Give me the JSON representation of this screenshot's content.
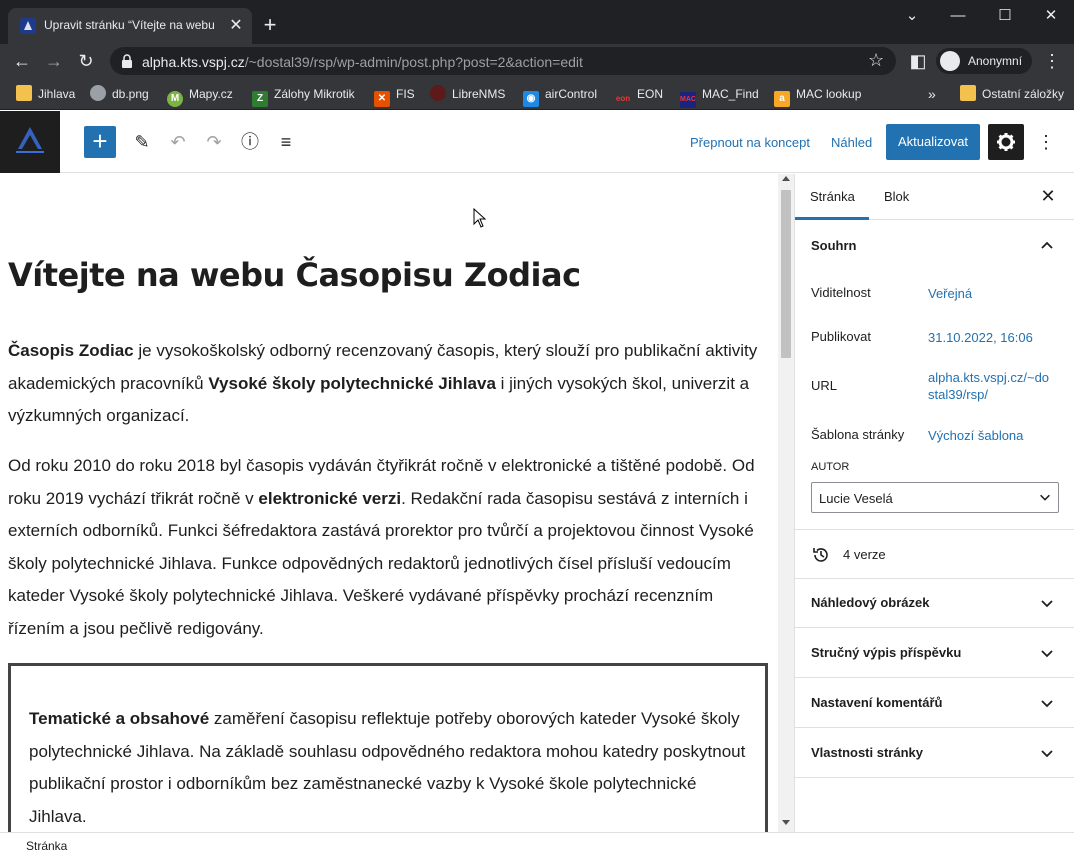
{
  "browser": {
    "tab_title": "Upravit stránku “Vítejte na webu",
    "url_host": "alpha.kts.vspj.cz",
    "url_path": "/~dostal39/rsp/wp-admin/post.php?post=2&action=edit",
    "profile_name": "Anonymní",
    "bookmarks": [
      {
        "label": "Jihlava",
        "icon": "folder-icon"
      },
      {
        "label": "db.png",
        "icon": "globe-icon"
      },
      {
        "label": "Mapy.cz",
        "icon": "mapy-icon"
      },
      {
        "label": "Zálohy Mikrotik",
        "icon": "mikrotik-icon"
      },
      {
        "label": "FIS",
        "icon": "fis-icon"
      },
      {
        "label": "LibreNMS",
        "icon": "librenms-icon"
      },
      {
        "label": "airControl",
        "icon": "aircontrol-icon"
      },
      {
        "label": "EON",
        "icon": "eon-icon"
      },
      {
        "label": "MAC_Find",
        "icon": "macfind-icon"
      },
      {
        "label": "MAC lookup",
        "icon": "maclookup-icon"
      }
    ],
    "overflow_label": "»",
    "other_bookmarks": "Ostatní záložky"
  },
  "editor": {
    "switch_to_draft": "Přepnout na koncept",
    "preview": "Náhled",
    "update": "Aktualizovat"
  },
  "post": {
    "title": "Vítejte na webu Časopisu Zodiac",
    "p1": [
      {
        "text": "Časopis Zodiac",
        "bold": true
      },
      {
        "text": " je vysokoškolský odborný recenzovaný časopis, který slouží pro publikační aktivity akademických pracovníků ",
        "bold": false
      },
      {
        "text": "Vysoké školy polytechnické Jihlava",
        "bold": true
      },
      {
        "text": " i jiných vysokých škol, univerzit a výzkumných organizací.",
        "bold": false
      }
    ],
    "p2": [
      {
        "text": "Od roku 2010 do roku 2018 byl časopis vydáván čtyřikrát ročně v elektronické a tištěné podobě. Od roku 2019 vychází třikrát ročně v ",
        "bold": false
      },
      {
        "text": "elektronické verzi",
        "bold": true
      },
      {
        "text": ". Redakční rada časopisu sestává z interních i externích odborníků. Funkci šéfredaktora zastává prorektor pro tvůrčí a projektovou činnost Vysoké školy polytechnické Jihlava. Funkce odpovědných redaktorů jednotlivých čísel přísluší vedoucím kateder Vysoké školy polytechnické Jihlava. Veškeré vydávané příspěvky prochází recenzním řízením a jsou pečlivě redigovány.",
        "bold": false
      }
    ],
    "p3": [
      {
        "text": "Tematické a obsahové",
        "bold": true
      },
      {
        "text": " zaměření časopisu reflektuje potřeby oborových kateder Vysoké školy polytechnické Jihlava. Na základě souhlasu odpovědného redaktora mohou katedry poskytnout publikační prostor i odborníkům bez zaměstnanecké vazby k Vysoké škole polytechnické Jihlava.",
        "bold": false
      }
    ]
  },
  "sidebar": {
    "tab_page": "Stránka",
    "tab_block": "Blok",
    "summary_title": "Souhrn",
    "visibility_label": "Viditelnost",
    "visibility_value": "Veřejná",
    "publish_label": "Publikovat",
    "publish_value": "31.10.2022, 16:06",
    "url_label": "URL",
    "url_value": "alpha.kts.vspj.cz/~dostal39/rsp/",
    "template_label": "Šablona stránky",
    "template_value": "Výchozí šablona",
    "author_label": "AUTOR",
    "author_value": "Lucie Veselá",
    "revisions": "4 verze",
    "panels": [
      "Náhledový obrázek",
      "Stručný výpis příspěvku",
      "Nastavení komentářů",
      "Vlastnosti stránky"
    ]
  },
  "footer": {
    "breadcrumb": "Stránka"
  },
  "colors": {
    "accent": "#2271b1",
    "chrome_dark": "#202124",
    "chrome_mid": "#35363a"
  }
}
